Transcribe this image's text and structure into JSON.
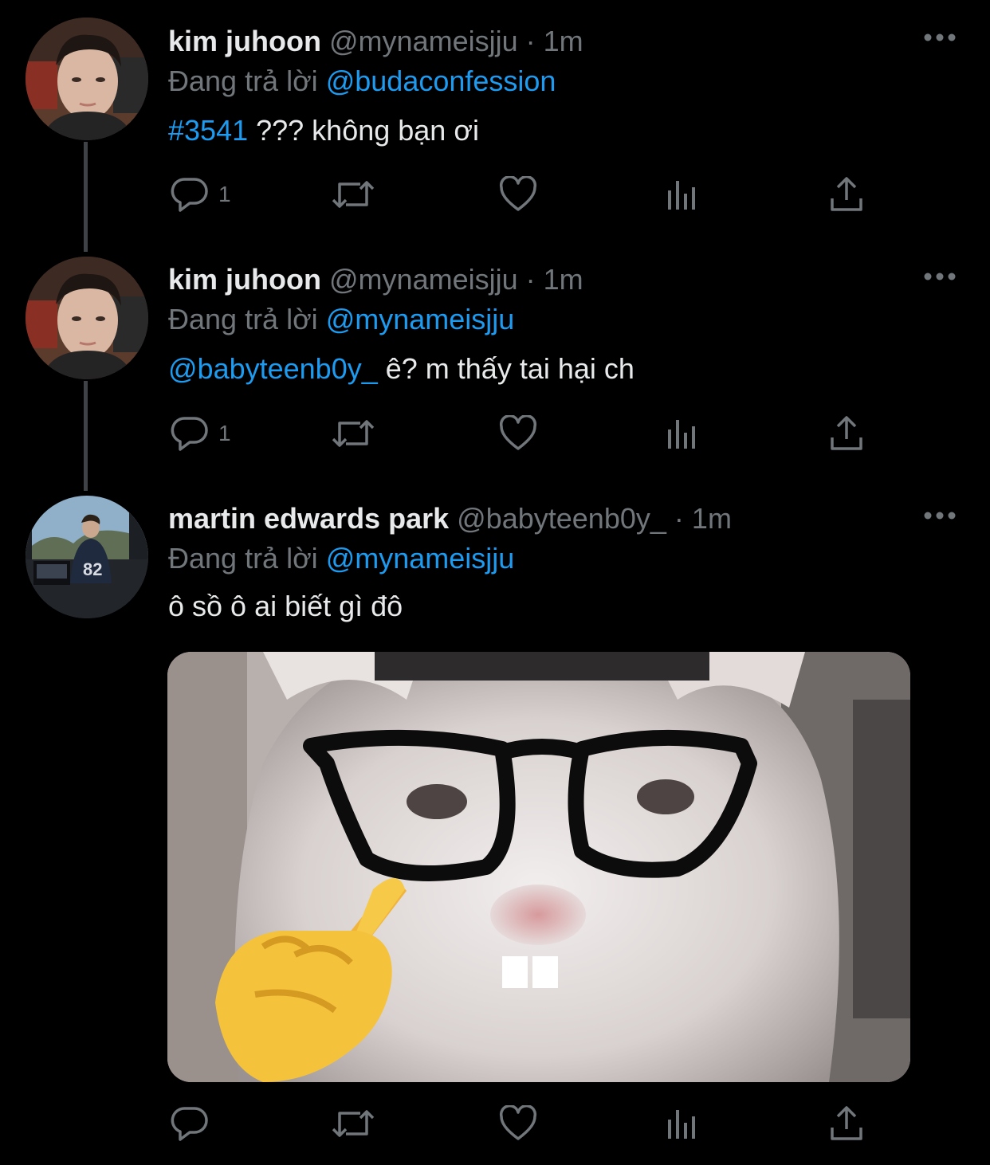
{
  "colors": {
    "background": "#000000",
    "primary_text": "#e7e9ea",
    "secondary_text": "#71767b",
    "link": "#1d9bf0",
    "thread_line": "#3f4347"
  },
  "tweets": [
    {
      "name": "kim juhoon",
      "handle": "@mynameisjju",
      "separator": "·",
      "time": "1m",
      "reply_prefix": "Đang trả lời",
      "reply_to": "@budaconfession",
      "text_link": "#3541",
      "text": " ??? không bạn ơi",
      "reply_count": "1",
      "avatar_icon": "user-avatar"
    },
    {
      "name": "kim juhoon",
      "handle": "@mynameisjju",
      "separator": "·",
      "time": "1m",
      "reply_prefix": "Đang trả lời",
      "reply_to": "@mynameisjju",
      "text_link": "@babyteenb0y_",
      "text": " ê? m thấy tai hại ch",
      "reply_count": "1",
      "avatar_icon": "user-avatar"
    },
    {
      "name": "martin edwards park",
      "handle": "@babyteenb0y_",
      "separator": "·",
      "time": "1m",
      "reply_prefix": "Đang trả lời",
      "reply_to": "@mynameisjju",
      "text_link": "",
      "text": "ô sồ ô ai biết gì đô",
      "reply_count": "",
      "avatar_icon": "user-avatar",
      "media": "cat-with-glasses-meme-image"
    }
  ],
  "icons": {
    "reply": "reply-icon",
    "retweet": "retweet-icon",
    "like": "like-icon",
    "views": "views-icon",
    "share": "share-icon",
    "more": "more-icon"
  }
}
